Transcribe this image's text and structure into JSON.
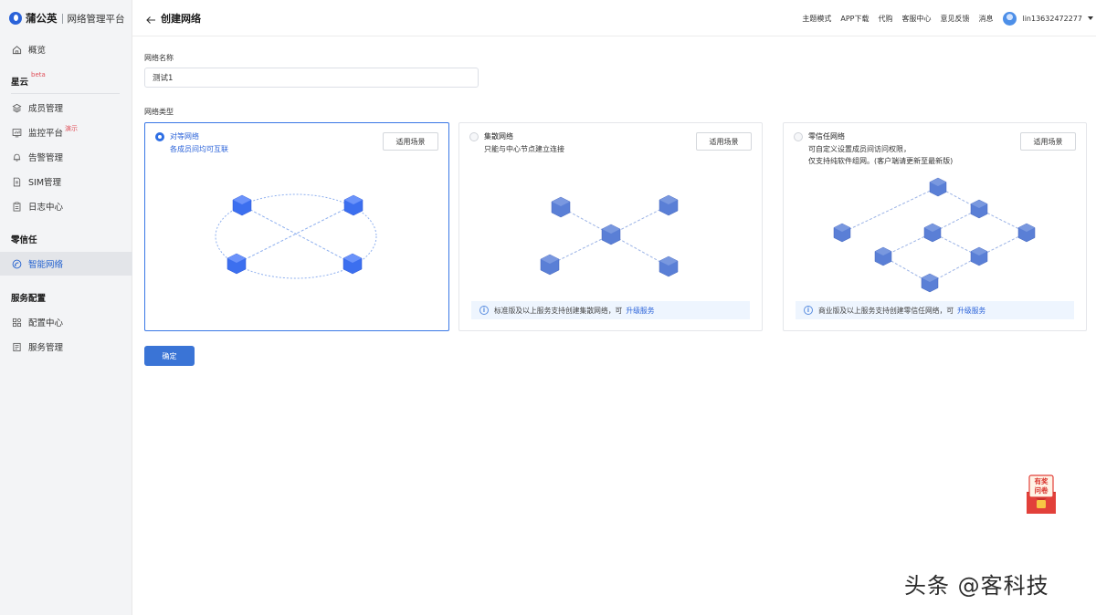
{
  "sidebar": {
    "brand": {
      "name": "蒲公英",
      "product": "网络管理平台"
    },
    "overview": "概览",
    "groups": [
      {
        "title": "星云",
        "badge": "beta"
      },
      {
        "title": "零信任"
      },
      {
        "title": "服务配置"
      }
    ],
    "items": [
      {
        "label": "成员管理"
      },
      {
        "label": "监控平台",
        "badge": "演示"
      },
      {
        "label": "告警管理"
      },
      {
        "label": "SIM管理"
      },
      {
        "label": "日志中心"
      },
      {
        "label": "智能网络",
        "active": true
      },
      {
        "label": "配置中心"
      },
      {
        "label": "服务管理"
      }
    ]
  },
  "header": {
    "title": "创建网络",
    "links": [
      "主题模式",
      "APP下载",
      "代购",
      "客服中心",
      "意见反馈",
      "消息"
    ],
    "username": "lin13632472277"
  },
  "form": {
    "name_label": "网络名称",
    "name_value": "测试1",
    "type_label": "网络类型",
    "scene_button": "适用场景",
    "confirm": "确定",
    "options": [
      {
        "title": "对等网络",
        "desc": [
          "各成员间均可互联"
        ],
        "selected": true
      },
      {
        "title": "集散网络",
        "desc": [
          "只能与中心节点建立连接"
        ],
        "selected": false,
        "notice": "标准版及以上服务支持创建集散网络，可",
        "upgrade": "升级服务"
      },
      {
        "title": "零信任网络",
        "desc": [
          "可自定义设置成员间访问权限，",
          "仅支持纯软件组网。(客户端请更新至最新版)"
        ],
        "selected": false,
        "notice": "商业版及以上服务支持创建零信任网络，可",
        "upgrade": "升级服务"
      }
    ]
  },
  "survey_badge": {
    "line1": "有奖",
    "line2": "问卷"
  },
  "watermark": "头条 @客科技",
  "colors": {
    "accent": "#2f6fe4",
    "button": "#3a74d6",
    "sidebar_bg": "#f3f4f6",
    "node": "#5a7fd6"
  }
}
